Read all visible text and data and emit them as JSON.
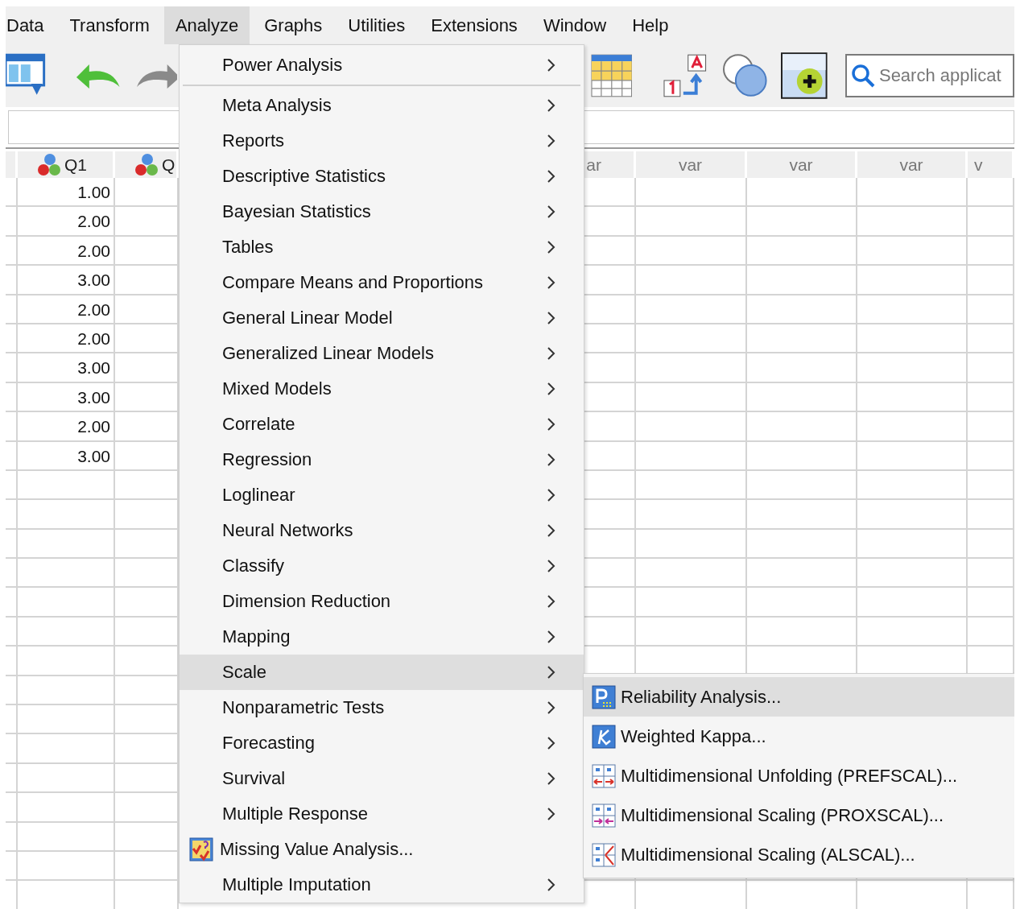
{
  "menubar": [
    {
      "label": "Data",
      "selected": false
    },
    {
      "label": "Transform",
      "selected": false
    },
    {
      "label": "Analyze",
      "selected": true
    },
    {
      "label": "Graphs",
      "selected": false
    },
    {
      "label": "Utilities",
      "selected": false
    },
    {
      "label": "Extensions",
      "selected": false
    },
    {
      "label": "Window",
      "selected": false
    },
    {
      "label": "Help",
      "selected": false
    }
  ],
  "toolbar": {
    "search": {
      "placeholder": "Search applicat"
    }
  },
  "grid": {
    "columns": [
      {
        "kind": "rownum"
      },
      {
        "kind": "variable",
        "label": "Q1"
      },
      {
        "kind": "variable",
        "label": "Q"
      },
      {
        "kind": "empty",
        "label": "ar"
      },
      {
        "kind": "empty",
        "label": "var"
      },
      {
        "kind": "empty",
        "label": "var"
      },
      {
        "kind": "empty",
        "label": "var"
      },
      {
        "kind": "empty",
        "label": "v"
      }
    ],
    "rows": [
      [
        "1.00"
      ],
      [
        "2.00"
      ],
      [
        "2.00"
      ],
      [
        "3.00"
      ],
      [
        "2.00"
      ],
      [
        "2.00"
      ],
      [
        "3.00"
      ],
      [
        "3.00"
      ],
      [
        "2.00"
      ],
      [
        "3.00"
      ]
    ]
  },
  "analyze_menu": {
    "items": [
      {
        "label": "Power Analysis",
        "kind": "submenu",
        "selected": false,
        "separator_after": true
      },
      {
        "label": "Meta Analysis",
        "kind": "submenu",
        "selected": false,
        "separator_after": false
      },
      {
        "label": "Reports",
        "kind": "submenu",
        "selected": false,
        "separator_after": false
      },
      {
        "label": "Descriptive Statistics",
        "kind": "submenu",
        "selected": false,
        "separator_after": false
      },
      {
        "label": "Bayesian Statistics",
        "kind": "submenu",
        "selected": false,
        "separator_after": false
      },
      {
        "label": "Tables",
        "kind": "submenu",
        "selected": false,
        "separator_after": false
      },
      {
        "label": "Compare Means and Proportions",
        "kind": "submenu",
        "selected": false,
        "separator_after": false
      },
      {
        "label": "General Linear Model",
        "kind": "submenu",
        "selected": false,
        "separator_after": false
      },
      {
        "label": "Generalized Linear Models",
        "kind": "submenu",
        "selected": false,
        "separator_after": false
      },
      {
        "label": "Mixed Models",
        "kind": "submenu",
        "selected": false,
        "separator_after": false
      },
      {
        "label": "Correlate",
        "kind": "submenu",
        "selected": false,
        "separator_after": false
      },
      {
        "label": "Regression",
        "kind": "submenu",
        "selected": false,
        "separator_after": false
      },
      {
        "label": "Loglinear",
        "kind": "submenu",
        "selected": false,
        "separator_after": false
      },
      {
        "label": "Neural Networks",
        "kind": "submenu",
        "selected": false,
        "separator_after": false
      },
      {
        "label": "Classify",
        "kind": "submenu",
        "selected": false,
        "separator_after": false
      },
      {
        "label": "Dimension Reduction",
        "kind": "submenu",
        "selected": false,
        "separator_after": false
      },
      {
        "label": "Mapping",
        "kind": "submenu",
        "selected": false,
        "separator_after": false
      },
      {
        "label": "Scale",
        "kind": "submenu",
        "selected": true,
        "separator_after": false
      },
      {
        "label": "Nonparametric Tests",
        "kind": "submenu",
        "selected": false,
        "separator_after": false
      },
      {
        "label": "Forecasting",
        "kind": "submenu",
        "selected": false,
        "separator_after": false
      },
      {
        "label": "Survival",
        "kind": "submenu",
        "selected": false,
        "separator_after": false
      },
      {
        "label": "Multiple Response",
        "kind": "submenu",
        "selected": false,
        "separator_after": false
      },
      {
        "label": "Missing Value Analysis...",
        "kind": "dialog",
        "selected": false,
        "separator_after": false
      },
      {
        "label": "Multiple Imputation",
        "kind": "submenu",
        "selected": false,
        "separator_after": false
      }
    ]
  },
  "scale_submenu": {
    "items": [
      {
        "label": "Reliability Analysis...",
        "selected": true
      },
      {
        "label": "Weighted Kappa...",
        "selected": false
      },
      {
        "label": "Multidimensional Unfolding (PREFSCAL)...",
        "selected": false
      },
      {
        "label": "Multidimensional Scaling (PROXSCAL)...",
        "selected": false
      },
      {
        "label": "Multidimensional Scaling (ALSCAL)...",
        "selected": false
      }
    ]
  }
}
